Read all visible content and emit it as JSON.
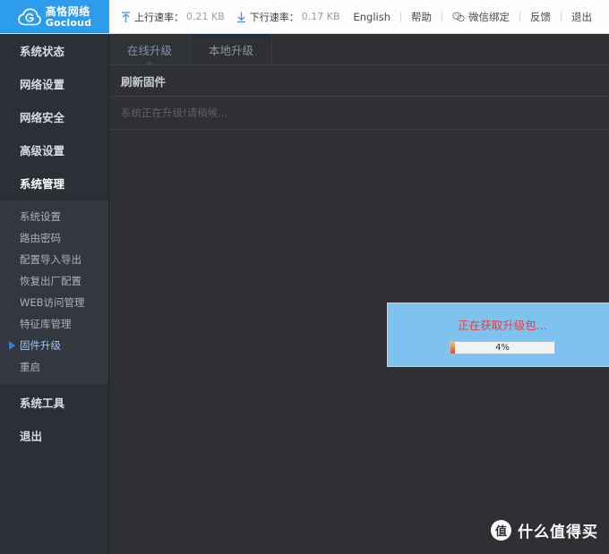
{
  "header": {
    "logo": {
      "cn": "高恪网络",
      "en": "Gocloud",
      "registered": "®",
      "icon": "cloud-g-logo"
    },
    "speeds": [
      {
        "icon": "upload-arrow-icon",
        "label": "上行速率：",
        "value": "0.21 KB"
      },
      {
        "icon": "download-arrow-icon",
        "label": "下行速率：",
        "value": "0.17 KB"
      }
    ],
    "links": [
      {
        "label": "English",
        "icon": ""
      },
      {
        "label": "帮助",
        "icon": ""
      },
      {
        "label": "微信绑定",
        "icon": "wechat-icon"
      },
      {
        "label": "反馈",
        "icon": ""
      },
      {
        "label": "退出",
        "icon": ""
      }
    ]
  },
  "sidebar": {
    "items": [
      {
        "label": "系统状态",
        "active": false
      },
      {
        "label": "网络设置",
        "active": false
      },
      {
        "label": "网络安全",
        "active": false
      },
      {
        "label": "高级设置",
        "active": false
      },
      {
        "label": "系统管理",
        "active": true
      },
      {
        "label": "系统工具",
        "active": false
      },
      {
        "label": "退出",
        "active": false
      }
    ],
    "submenu": [
      {
        "label": "系统设置",
        "active": false
      },
      {
        "label": "路由密码",
        "active": false
      },
      {
        "label": "配置导入导出",
        "active": false
      },
      {
        "label": "恢复出厂配置",
        "active": false
      },
      {
        "label": "WEB访问管理",
        "active": false
      },
      {
        "label": "特征库管理",
        "active": false
      },
      {
        "label": "固件升级",
        "active": true
      },
      {
        "label": "重启",
        "active": false
      }
    ]
  },
  "main": {
    "tabs": [
      {
        "label": "在线升级",
        "active": true
      },
      {
        "label": "本地升级",
        "active": false
      }
    ],
    "section_title": "刷新固件",
    "status_text": "系统正在升级!请稍候..."
  },
  "modal": {
    "message": "正在获取升级包...",
    "progress_percent": "4%",
    "progress_value": 4
  },
  "watermark": {
    "badge": "值",
    "text": "什么值得买"
  },
  "colors": {
    "brand_blue": "#2d9cec",
    "sidebar_bg": "#2b2f36",
    "submenu_bg": "#33373f",
    "content_bg": "#2e3033",
    "modal_bg": "#7ec2ef",
    "modal_text_red": "#ef3b3b",
    "active_tab_text": "#7e93b5"
  }
}
